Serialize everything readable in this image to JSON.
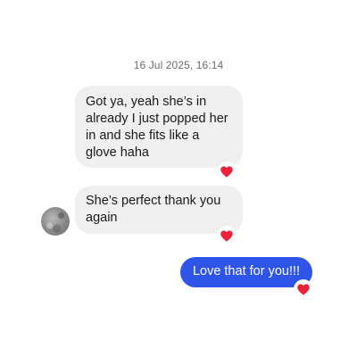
{
  "timestamp": "16 Jul 2025, 16:14",
  "messages": [
    {
      "direction": "incoming",
      "text": "Got ya, yeah she’s in already I just popped her in and she fits like a glove haha",
      "reaction": "heart"
    },
    {
      "direction": "incoming",
      "text": "She’s perfect thank you again",
      "reaction": "heart"
    },
    {
      "direction": "outgoing",
      "text": "Love that for you!!!",
      "reaction": "heart"
    }
  ],
  "colors": {
    "incoming_bubble": "#efefef",
    "outgoing_bubble": "#2f55e8",
    "reaction_heart": "#e8233a",
    "timestamp_text": "#6b6b6b"
  },
  "icons": {
    "reaction": "heart-icon",
    "avatar": "contact-avatar"
  }
}
